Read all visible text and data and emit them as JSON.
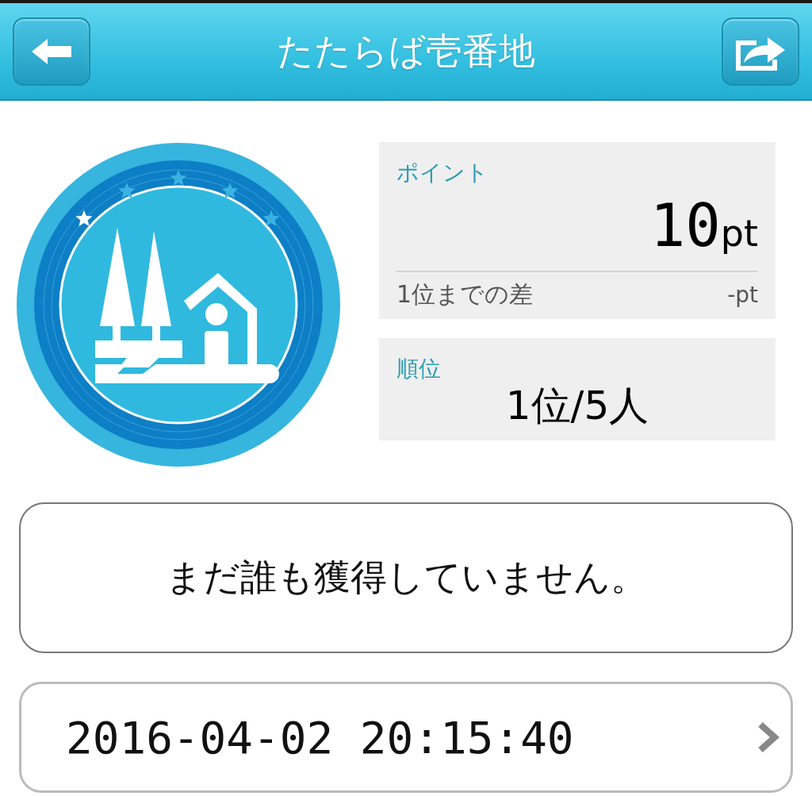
{
  "header": {
    "title": "たたらば壱番地"
  },
  "points_card": {
    "label": "ポイント",
    "value": "10",
    "unit": "pt",
    "gap_label": "1位までの差",
    "gap_value": "-pt"
  },
  "rank_card": {
    "label": "順位",
    "value": "1位/5人"
  },
  "message": "まだ誰も獲得していません。",
  "history": [
    {
      "timestamp": "2016-04-02 20:15:40"
    }
  ]
}
